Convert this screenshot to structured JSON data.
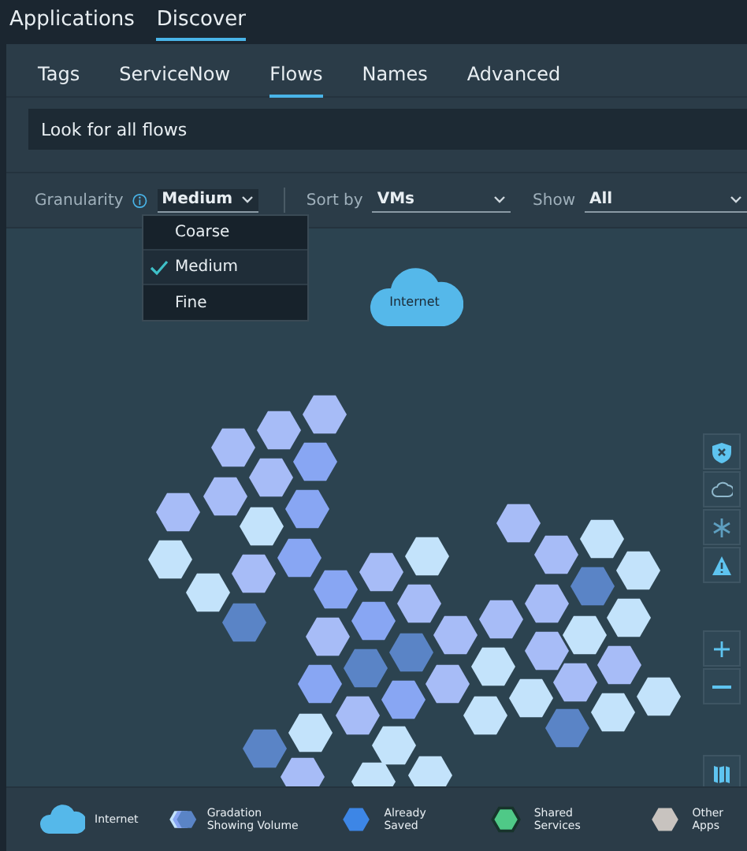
{
  "top_tabs": [
    {
      "label": "Applications",
      "selected": false
    },
    {
      "label": "Discover",
      "selected": true
    }
  ],
  "sub_tabs": [
    {
      "label": "Tags",
      "selected": false
    },
    {
      "label": "ServiceNow",
      "selected": false
    },
    {
      "label": "Flows",
      "selected": true
    },
    {
      "label": "Names",
      "selected": false
    },
    {
      "label": "Advanced",
      "selected": false
    }
  ],
  "search": {
    "value": "Look for all flows"
  },
  "filters": {
    "granularity": {
      "label": "Granularity",
      "value": "Medium"
    },
    "sort": {
      "label": "Sort by",
      "value": "VMs"
    },
    "show": {
      "label": "Show",
      "value": "All"
    }
  },
  "granularity_menu": [
    {
      "label": "Coarse",
      "selected": false
    },
    {
      "label": "Medium",
      "selected": true
    },
    {
      "label": "Fine",
      "selected": false
    }
  ],
  "map": {
    "internet_label": "Internet"
  },
  "legend": [
    {
      "kind": "cloud",
      "label": "Internet"
    },
    {
      "kind": "gradation",
      "label": "Gradation Showing Volume"
    },
    {
      "kind": "saved",
      "label": "Already Saved"
    },
    {
      "kind": "shared",
      "label": "Shared Services"
    },
    {
      "kind": "other",
      "label": "Other Apps"
    }
  ]
}
